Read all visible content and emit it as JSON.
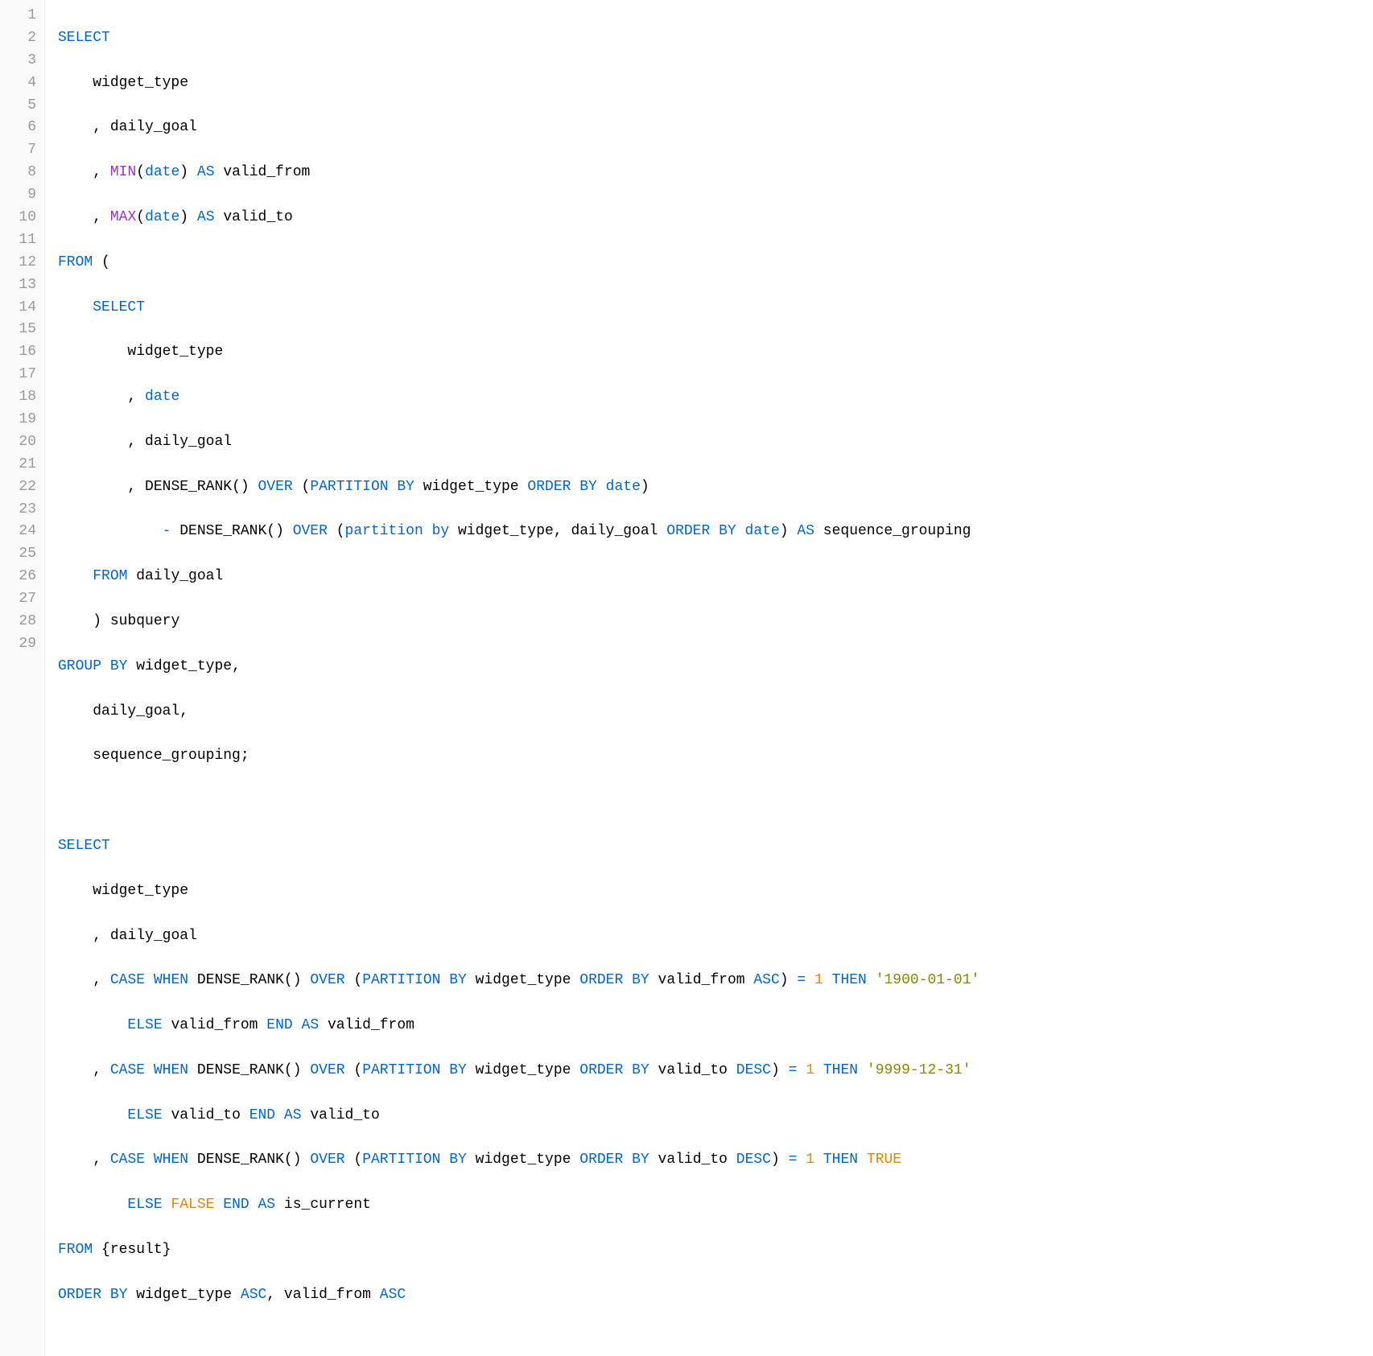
{
  "colors": {
    "keyword": "#0066cc",
    "function": "#9933cc",
    "number": "#dd8800",
    "string": "#888800",
    "boolean": "#dd8800",
    "text": "#000000",
    "gutter_bg": "#fafafa",
    "gutter_fg": "#999999"
  },
  "line_numbers": [
    "1",
    "2",
    "3",
    "4",
    "5",
    "6",
    "7",
    "8",
    "9",
    "10",
    "11",
    "12",
    "13",
    "14",
    "15",
    "16",
    "17",
    "18",
    "19",
    "20",
    "21",
    "22",
    "23",
    "24",
    "25",
    "26",
    "27",
    "28",
    "29"
  ],
  "tokens": {
    "kw_select": "SELECT",
    "kw_from": "FROM",
    "kw_as": "AS",
    "kw_over": "OVER",
    "kw_partition": "PARTITION",
    "kw_partition_lc": "partition",
    "kw_by": "BY",
    "kw_by_lc": "by",
    "kw_order": "ORDER",
    "kw_group": "GROUP",
    "kw_case": "CASE",
    "kw_when": "WHEN",
    "kw_then": "THEN",
    "kw_else": "ELSE",
    "kw_end": "END",
    "kw_asc": "ASC",
    "kw_desc": "DESC",
    "fn_min": "MIN",
    "fn_max": "MAX",
    "fn_dense_rank": "DENSE_RANK()",
    "id_widget_type": "widget_type",
    "id_daily_goal": "daily_goal",
    "id_date": "date",
    "id_valid_from": "valid_from",
    "id_valid_to": "valid_to",
    "id_sequence_grouping": "sequence_grouping",
    "id_subquery": "subquery",
    "id_is_current": "is_current",
    "id_result": "{result}",
    "num_1": "1",
    "str_1900": "'1900-01-01'",
    "str_9999": "'9999-12-31'",
    "bool_true": "TRUE",
    "bool_false": "FALSE",
    "comma": ",",
    "lparen": "(",
    "rparen": ")",
    "close_paren_sub": ") subquery",
    "minus": "-",
    "eq": "=",
    "semicolon": ";"
  },
  "plain_sql": "SELECT\n    widget_type\n    , daily_goal\n    , MIN(date) AS valid_from\n    , MAX(date) AS valid_to\nFROM (\n    SELECT\n        widget_type\n        , date\n        , daily_goal\n        , DENSE_RANK() OVER (PARTITION BY widget_type ORDER BY date)\n            - DENSE_RANK() OVER (partition by widget_type, daily_goal ORDER BY date) AS sequence_grouping\n    FROM daily_goal\n    ) subquery\nGROUP BY widget_type,\n    daily_goal,\n    sequence_grouping;\n\nSELECT\n    widget_type\n    , daily_goal\n    , CASE WHEN DENSE_RANK() OVER (PARTITION BY widget_type ORDER BY valid_from ASC) = 1 THEN '1900-01-01'\n        ELSE valid_from END AS valid_from\n    , CASE WHEN DENSE_RANK() OVER (PARTITION BY widget_type ORDER BY valid_to DESC) = 1 THEN '9999-12-31'\n        ELSE valid_to END AS valid_to\n    , CASE WHEN DENSE_RANK() OVER (PARTITION BY widget_type ORDER BY valid_to DESC) = 1 THEN TRUE\n        ELSE FALSE END AS is_current\nFROM {result}\nORDER BY widget_type ASC, valid_from ASC"
}
